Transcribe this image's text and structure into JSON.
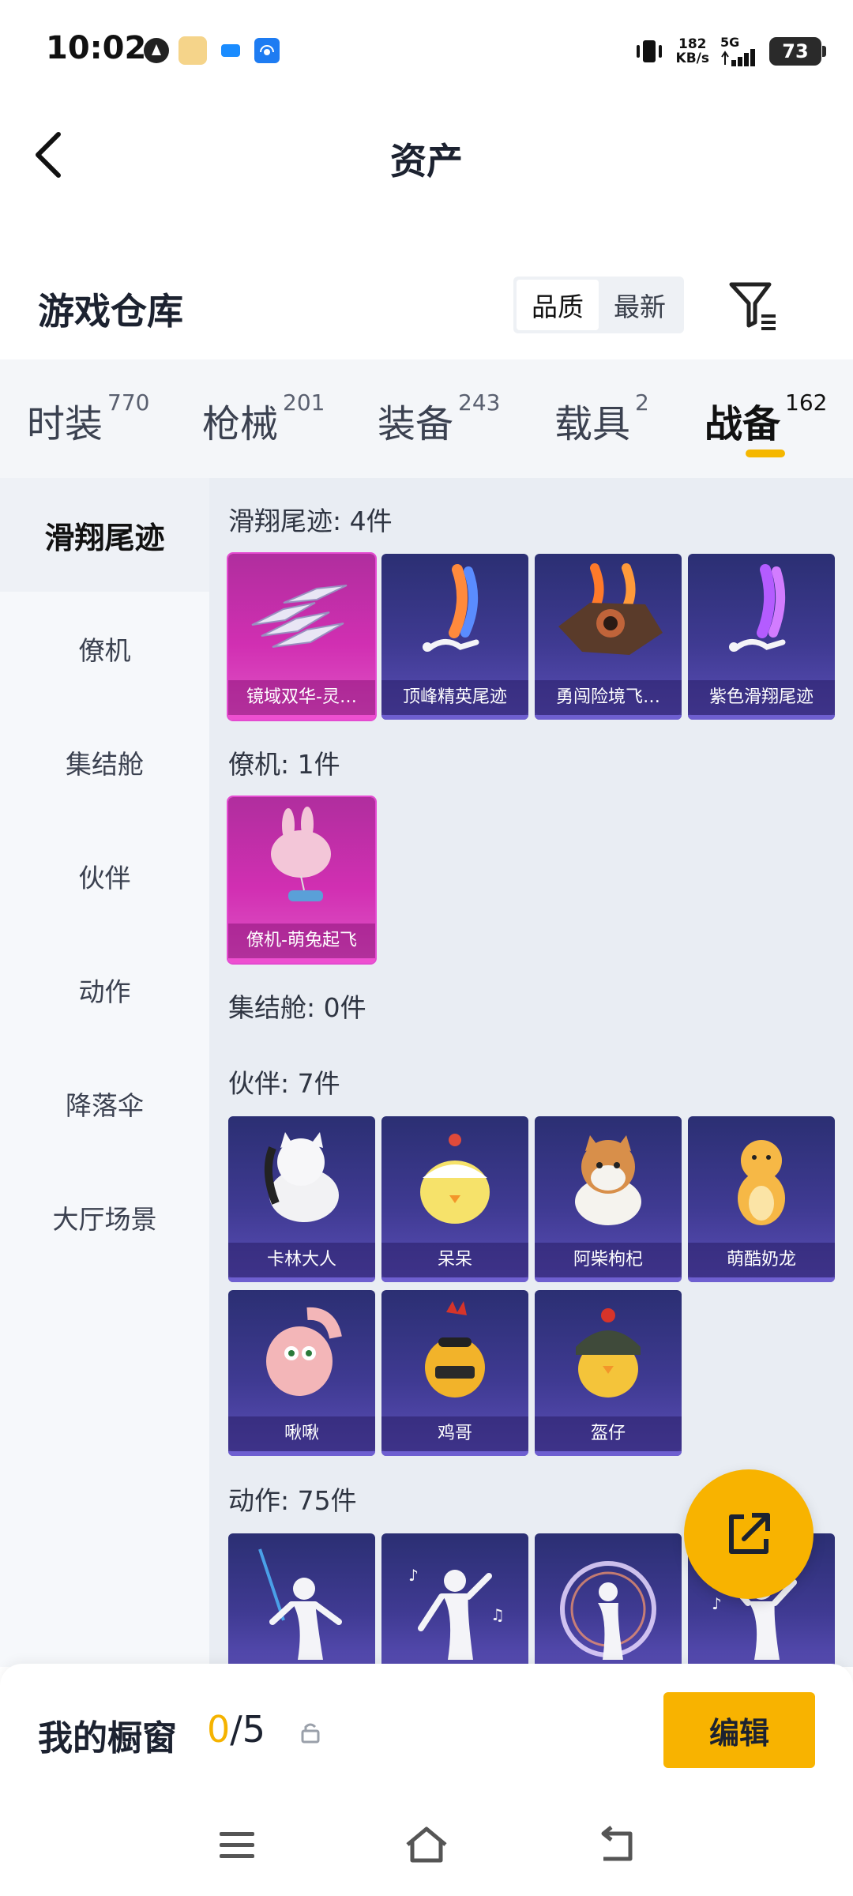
{
  "status": {
    "time": "10:02",
    "net_speed_value": "182",
    "net_speed_unit": "KB/s",
    "signal_label": "5G",
    "battery": "73"
  },
  "header": {
    "title": "资产"
  },
  "section": {
    "title": "游戏仓库",
    "sort_options": [
      "品质",
      "最新"
    ],
    "sort_active": "品质"
  },
  "tabs": [
    {
      "label": "时装",
      "count": "770"
    },
    {
      "label": "枪械",
      "count": "201"
    },
    {
      "label": "装备",
      "count": "243"
    },
    {
      "label": "载具",
      "count": "2"
    },
    {
      "label": "战备",
      "count": "162",
      "active": true
    }
  ],
  "left_nav": [
    {
      "label": "滑翔尾迹",
      "active": true
    },
    {
      "label": "僚机"
    },
    {
      "label": "集结舱"
    },
    {
      "label": "伙伴"
    },
    {
      "label": "动作"
    },
    {
      "label": "降落伞"
    },
    {
      "label": "大厅场景"
    }
  ],
  "groups": [
    {
      "title": "滑翔尾迹: 4件",
      "items": [
        "镜域双华-灵…",
        "顶峰精英尾迹",
        "勇闯险境飞…",
        "紫色滑翔尾迹"
      ]
    },
    {
      "title": "僚机: 1件",
      "items": [
        "僚机-萌兔起飞"
      ]
    },
    {
      "title": "集结舱: 0件",
      "items": []
    },
    {
      "title": "伙伴: 7件",
      "items": [
        "卡林大人",
        "呆呆",
        "阿柴枸杞",
        "萌酷奶龙",
        "啾啾",
        "鸡哥",
        "盔仔"
      ]
    },
    {
      "title": "动作: 75件",
      "items": []
    }
  ],
  "bottom": {
    "showcase_label": "我的橱窗",
    "showcase_current": "0",
    "showcase_total": "/5",
    "edit_label": "编辑"
  },
  "colors": {
    "accent": "#f8b300",
    "card_epic": "#3f3a92",
    "card_legendary": "#d12fb2"
  }
}
